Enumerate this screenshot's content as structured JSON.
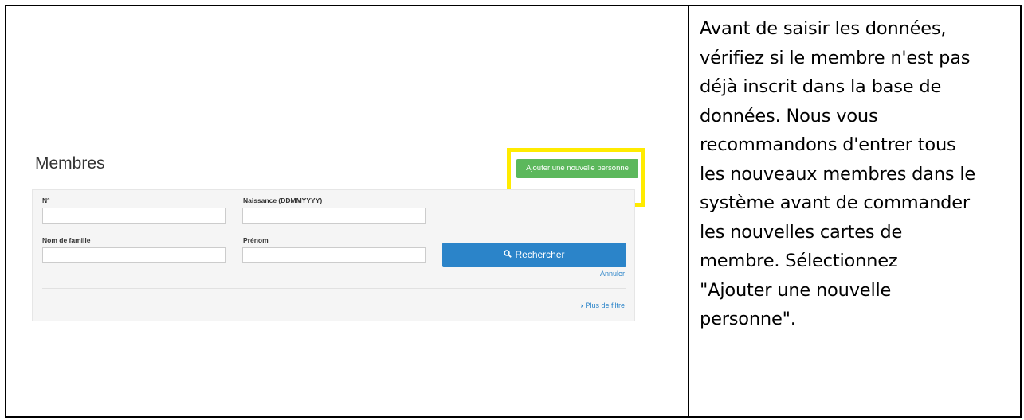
{
  "instructions": {
    "text": "Avant de saisir les données,\nvérifiez si le membre n'est pas\ndéjà inscrit dans la base de\ndonnées. Nous vous\nrecommandons d'entrer tous\nles nouveaux membres dans le\nsystème avant de commander\nles nouvelles cartes de\nmembre. Sélectionnez\n\"Ajouter une nouvelle\npersonne\"."
  },
  "screenshot": {
    "title": "Membres",
    "add_button_label": "Ajouter une nouvelle personne",
    "highlight_color": "#ffeb00",
    "fields": {
      "number_label": "N°",
      "birth_label": "Naissance (DDMMYYYY)",
      "lastname_label": "Nom de famille",
      "firstname_label": "Prénom",
      "number_value": "",
      "birth_value": "",
      "lastname_value": "",
      "firstname_value": ""
    },
    "search_button_label": "Rechercher",
    "search_icon": "search-icon",
    "cancel_label": "Annuler",
    "more_filter_label": "Plus de filtre",
    "colors": {
      "add_button": "#5cb85c",
      "search_button": "#2b84c9",
      "link": "#2b84c9"
    }
  }
}
